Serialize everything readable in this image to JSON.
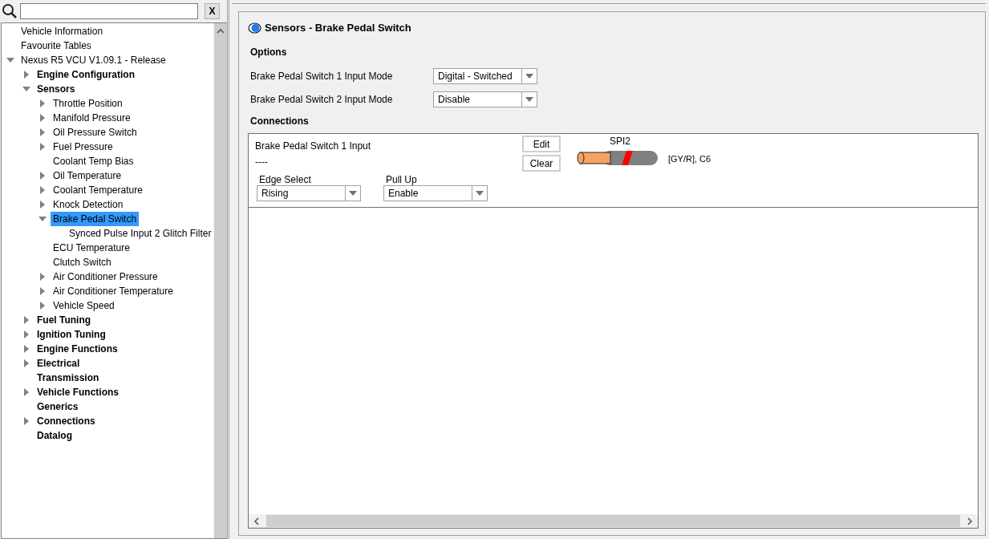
{
  "search": {
    "clear_label": "X"
  },
  "tree": [
    {
      "label": "Vehicle Information",
      "selected": false
    },
    {
      "label": "Favourite Tables",
      "selected": false
    },
    {
      "label": "Nexus R5 VCU V1.09.1 - Release",
      "expanded": true,
      "selected": false,
      "children": [
        {
          "label": "Engine Configuration",
          "expanded": false,
          "selected": false
        },
        {
          "label": "Sensors",
          "expanded": true,
          "selected": false,
          "children": [
            {
              "label": "Throttle Position",
              "expanded": false,
              "selected": false
            },
            {
              "label": "Manifold Pressure",
              "expanded": false,
              "selected": false
            },
            {
              "label": "Oil Pressure Switch",
              "expanded": false,
              "selected": false
            },
            {
              "label": "Fuel Pressure",
              "expanded": false,
              "selected": false
            },
            {
              "label": "Coolant Temp Bias",
              "selected": false
            },
            {
              "label": "Oil Temperature",
              "expanded": false,
              "selected": false
            },
            {
              "label": "Coolant Temperature",
              "expanded": false,
              "selected": false
            },
            {
              "label": "Knock Detection",
              "expanded": false,
              "selected": false
            },
            {
              "label": "Brake Pedal Switch",
              "expanded": true,
              "selected": true,
              "children": [
                {
                  "label": "Synced Pulse Input 2 Glitch Filter",
                  "selected": false
                }
              ]
            },
            {
              "label": "ECU Temperature",
              "selected": false
            },
            {
              "label": "Clutch Switch",
              "selected": false
            },
            {
              "label": "Air Conditioner Pressure",
              "expanded": false,
              "selected": false
            },
            {
              "label": "Air Conditioner Temperature",
              "expanded": false,
              "selected": false
            },
            {
              "label": "Vehicle Speed",
              "expanded": false,
              "selected": false
            }
          ]
        },
        {
          "label": "Fuel Tuning",
          "expanded": false,
          "selected": false
        },
        {
          "label": "Ignition Tuning",
          "expanded": false,
          "selected": false
        },
        {
          "label": "Engine Functions",
          "expanded": false,
          "selected": false
        },
        {
          "label": "Electrical",
          "expanded": false,
          "selected": false
        },
        {
          "label": "Transmission",
          "selected": false
        },
        {
          "label": "Vehicle Functions",
          "expanded": false,
          "selected": false
        },
        {
          "label": "Generics",
          "selected": false
        },
        {
          "label": "Connections",
          "expanded": false,
          "selected": false
        },
        {
          "label": "Datalog",
          "selected": false
        }
      ]
    }
  ],
  "page": {
    "title": "Sensors - Brake Pedal Switch",
    "options_heading": "Options",
    "options": [
      {
        "label": "Brake Pedal Switch 1 Input Mode",
        "value": "Digital - Switched"
      },
      {
        "label": "Brake Pedal Switch 2 Input Mode",
        "value": "Disable"
      }
    ],
    "connections_heading": "Connections",
    "connection": {
      "name": "Brake Pedal Switch 1 Input",
      "pin": "----",
      "edit_label": "Edit",
      "clear_label": "Clear",
      "wire_label": "SPI2",
      "wire_info": "[GY/R], C6",
      "fields": [
        {
          "label": "Edge Select",
          "value": "Rising"
        },
        {
          "label": "Pull Up",
          "value": "Enable"
        }
      ]
    }
  }
}
